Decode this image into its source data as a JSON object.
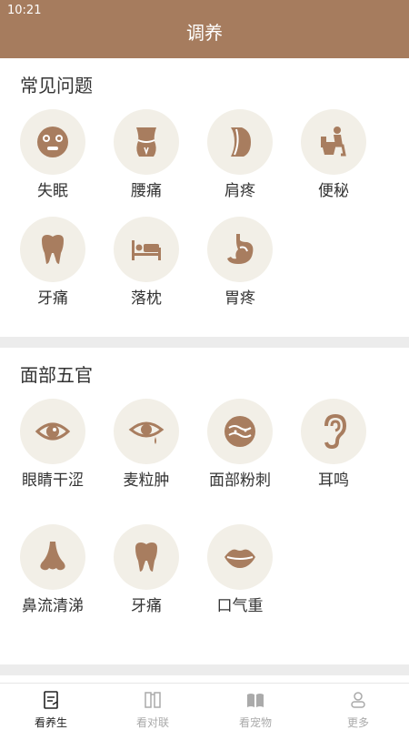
{
  "status": {
    "time": "10:21"
  },
  "header": {
    "title": "调养"
  },
  "sections": [
    {
      "title": "常见问题",
      "items": [
        {
          "label": "失眠",
          "icon": "face-icon"
        },
        {
          "label": "腰痛",
          "icon": "waist-icon"
        },
        {
          "label": "肩疼",
          "icon": "shoulder-icon"
        },
        {
          "label": "便秘",
          "icon": "toilet-icon"
        },
        {
          "label": "牙痛",
          "icon": "tooth-icon"
        },
        {
          "label": "落枕",
          "icon": "bed-icon"
        },
        {
          "label": "胃疼",
          "icon": "stomach-icon"
        }
      ]
    },
    {
      "title": "面部五官",
      "items": [
        {
          "label": "眼睛干涩",
          "icon": "eye-icon"
        },
        {
          "label": "麦粒肿",
          "icon": "eye-drop-icon"
        },
        {
          "label": "面部粉刺",
          "icon": "skin-icon"
        },
        {
          "label": "耳鸣",
          "icon": "ear-icon"
        },
        {
          "label": "鼻流清涕",
          "icon": "nose-icon"
        },
        {
          "label": "牙痛",
          "icon": "tooth-icon"
        },
        {
          "label": "口气重",
          "icon": "lips-icon"
        }
      ]
    }
  ],
  "tabs": [
    {
      "label": "看养生",
      "icon": "notebook-icon",
      "active": true
    },
    {
      "label": "看对联",
      "icon": "couplet-icon",
      "active": false
    },
    {
      "label": "看宠物",
      "icon": "book-icon",
      "active": false
    },
    {
      "label": "更多",
      "icon": "user-icon",
      "active": false
    }
  ],
  "colors": {
    "brand": "#a67c5e",
    "icon": "#a87d5f",
    "circle_bg": "#f2efe7",
    "divider": "#ececec"
  }
}
